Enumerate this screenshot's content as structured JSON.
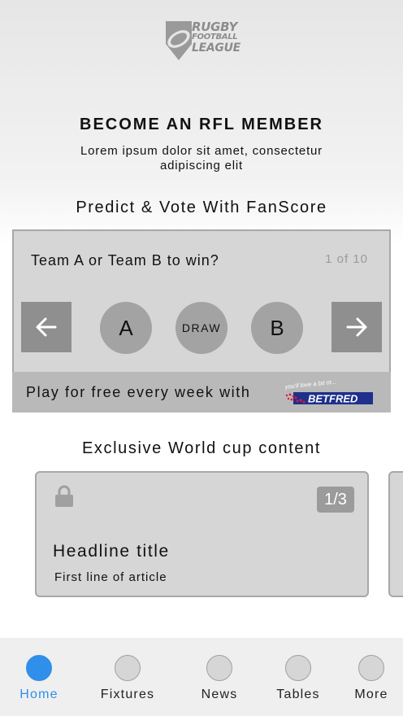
{
  "logo": {
    "line1": "RUGBY",
    "line2": "FOOTBALL",
    "line3": "LEAGUE"
  },
  "membership": {
    "title": "BECOME AN RFL MEMBER",
    "subtitle": "Lorem ipsum dolor sit amet, consectetur adipiscing elit"
  },
  "predict": {
    "section_title": "Predict & Vote With FanScore",
    "question": "Team A or Team B to win?",
    "counter": "1 of 10",
    "options": {
      "a": "A",
      "draw": "DRAW",
      "b": "B"
    },
    "footer_text": "Play for free every week with",
    "sponsor": {
      "tagline": "you'll love a bit of...",
      "name": "BETFRED"
    }
  },
  "exclusive": {
    "section_title": "Exclusive World cup content",
    "card": {
      "badge": "1/3",
      "headline": "Headline title",
      "first_line": "First line of article"
    }
  },
  "tabs": [
    {
      "label": "Home",
      "active": true
    },
    {
      "label": "Fixtures",
      "active": false
    },
    {
      "label": "News",
      "active": false
    },
    {
      "label": "Tables",
      "active": false
    },
    {
      "label": "More",
      "active": false
    }
  ],
  "colors": {
    "accent": "#2f8fea",
    "sponsor_blue": "#1e2f8c",
    "sponsor_red": "#d8183c"
  }
}
